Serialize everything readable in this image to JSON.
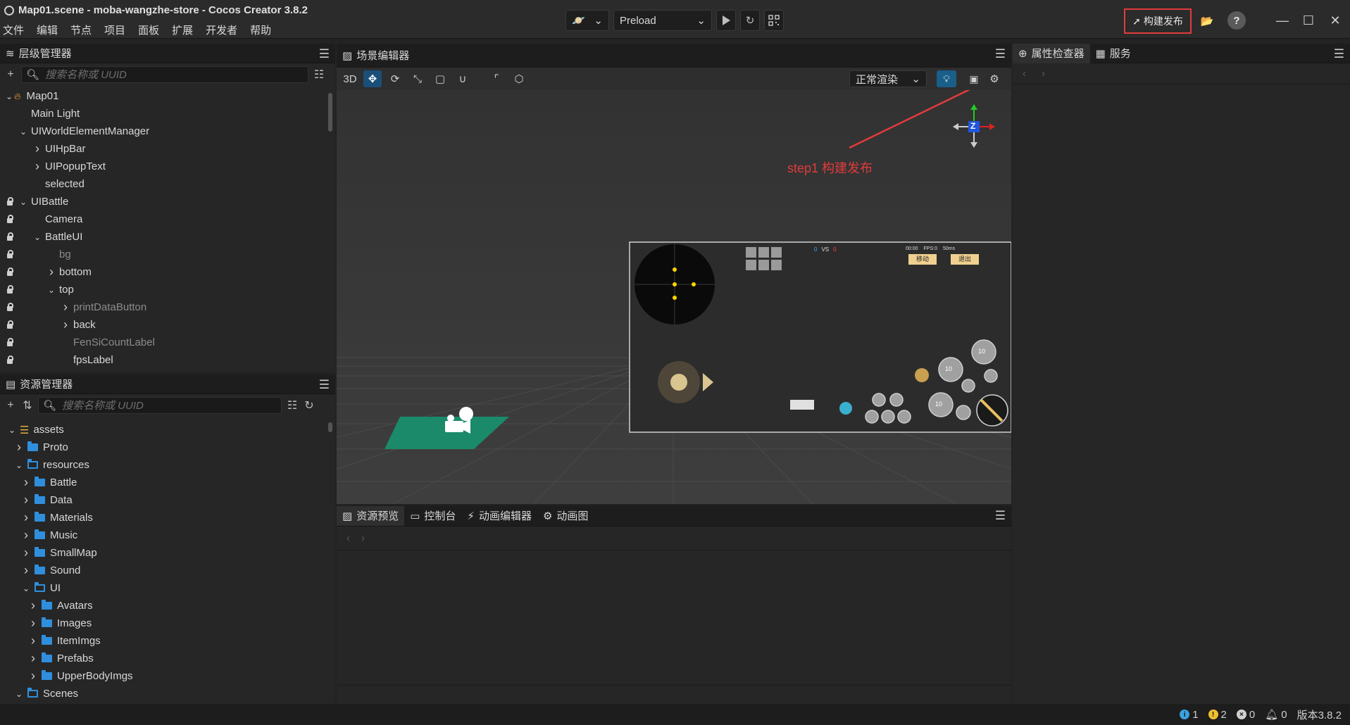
{
  "window": {
    "title": "Map01.scene - moba-wangzhe-store - Cocos Creator 3.8.2",
    "menu": [
      "文件",
      "编辑",
      "节点",
      "项目",
      "面板",
      "扩展",
      "开发者",
      "帮助"
    ]
  },
  "toolbar": {
    "scene_select_value": "Preload",
    "build_label": "构建发布"
  },
  "annotation": {
    "text": "step1 构建发布",
    "color": "#e23b3b"
  },
  "hierarchy": {
    "title": "层级管理器",
    "search_placeholder": "搜索名称或 UUID",
    "rows": [
      {
        "label": "Map01",
        "depth": 0,
        "arrow": "down",
        "locked": false,
        "dim": false,
        "icon": "fire-icon"
      },
      {
        "label": "Main Light",
        "depth": 1,
        "arrow": "none",
        "locked": false,
        "dim": false
      },
      {
        "label": "UIWorldElementManager",
        "depth": 1,
        "arrow": "down",
        "locked": false,
        "dim": false
      },
      {
        "label": "UIHpBar",
        "depth": 2,
        "arrow": "right",
        "locked": false,
        "dim": false
      },
      {
        "label": "UIPopupText",
        "depth": 2,
        "arrow": "right",
        "locked": false,
        "dim": false
      },
      {
        "label": "selected",
        "depth": 2,
        "arrow": "none",
        "locked": false,
        "dim": false
      },
      {
        "label": "UIBattle",
        "depth": 1,
        "arrow": "down",
        "locked": true,
        "dim": false
      },
      {
        "label": "Camera",
        "depth": 2,
        "arrow": "none",
        "locked": true,
        "dim": false
      },
      {
        "label": "BattleUI",
        "depth": 2,
        "arrow": "down",
        "locked": true,
        "dim": false
      },
      {
        "label": "bg",
        "depth": 3,
        "arrow": "none",
        "locked": true,
        "dim": true
      },
      {
        "label": "bottom",
        "depth": 3,
        "arrow": "right",
        "locked": true,
        "dim": false
      },
      {
        "label": "top",
        "depth": 3,
        "arrow": "down",
        "locked": true,
        "dim": false
      },
      {
        "label": "printDataButton",
        "depth": 4,
        "arrow": "right",
        "locked": true,
        "dim": true
      },
      {
        "label": "back",
        "depth": 4,
        "arrow": "right",
        "locked": true,
        "dim": false
      },
      {
        "label": "FenSiCountLabel",
        "depth": 4,
        "arrow": "none",
        "locked": true,
        "dim": true
      },
      {
        "label": "fpsLabel",
        "depth": 4,
        "arrow": "none",
        "locked": true,
        "dim": false
      }
    ]
  },
  "assets": {
    "title": "资源管理器",
    "search_placeholder": "搜索名称或 UUID",
    "rows": [
      {
        "label": "assets",
        "depth": 0,
        "arrow": "down",
        "kind": "db"
      },
      {
        "label": "Proto",
        "depth": 1,
        "arrow": "right",
        "kind": "folder"
      },
      {
        "label": "resources",
        "depth": 1,
        "arrow": "down",
        "kind": "folder-open"
      },
      {
        "label": "Battle",
        "depth": 2,
        "arrow": "right",
        "kind": "folder"
      },
      {
        "label": "Data",
        "depth": 2,
        "arrow": "right",
        "kind": "folder"
      },
      {
        "label": "Materials",
        "depth": 2,
        "arrow": "right",
        "kind": "folder"
      },
      {
        "label": "Music",
        "depth": 2,
        "arrow": "right",
        "kind": "folder"
      },
      {
        "label": "SmallMap",
        "depth": 2,
        "arrow": "right",
        "kind": "folder"
      },
      {
        "label": "Sound",
        "depth": 2,
        "arrow": "right",
        "kind": "folder"
      },
      {
        "label": "UI",
        "depth": 2,
        "arrow": "down",
        "kind": "folder-open"
      },
      {
        "label": "Avatars",
        "depth": 3,
        "arrow": "right",
        "kind": "folder"
      },
      {
        "label": "Images",
        "depth": 3,
        "arrow": "right",
        "kind": "folder"
      },
      {
        "label": "ItemImgs",
        "depth": 3,
        "arrow": "right",
        "kind": "folder"
      },
      {
        "label": "Prefabs",
        "depth": 3,
        "arrow": "right",
        "kind": "folder"
      },
      {
        "label": "UpperBodyImgs",
        "depth": 3,
        "arrow": "right",
        "kind": "folder"
      },
      {
        "label": "Scenes",
        "depth": 1,
        "arrow": "down",
        "kind": "folder-open"
      }
    ]
  },
  "scene_editor": {
    "title": "场景编辑器",
    "mode_3d": "3D",
    "render_mode": "正常渲染",
    "gizmo_axis": "Z",
    "game_ui": {
      "vs_left": "0",
      "vs_label": "VS",
      "vs_right": "0",
      "time": "00:00",
      "fps": "FPS:0",
      "ping": "50ms",
      "btn_move": "移动",
      "btn_exit": "退出",
      "skill_level": "10"
    }
  },
  "inspector": {
    "tabs": [
      "属性检查器",
      "服务"
    ]
  },
  "bottom_panel": {
    "tabs": [
      "资源预览",
      "控制台",
      "动画编辑器",
      "动画图"
    ]
  },
  "status": {
    "info_count": "1",
    "warn_count": "2",
    "error_count": "0",
    "notify_count": "0",
    "version": "版本3.8.2",
    "info_color": "#3ba1e0",
    "warn_color": "#f0c030",
    "error_color": "#d0d0d0"
  }
}
